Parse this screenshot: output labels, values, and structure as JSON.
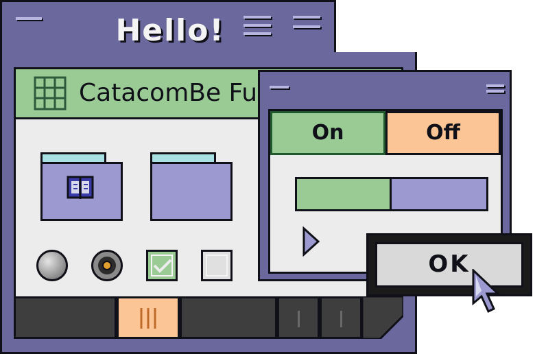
{
  "main_window": {
    "title": "Hello!",
    "path_label": "CatacomBe Fu"
  },
  "dialog": {
    "toggle_on_label": "On",
    "toggle_off_label": "Off",
    "toggle_selected": "On",
    "progress": 0.5
  },
  "ok_button": {
    "label": "OK"
  },
  "colors": {
    "window_frame": "#6a689c",
    "accent_green": "#9bcb95",
    "accent_orange": "#fbc596",
    "folder_purple": "#9b99cf",
    "folder_tab": "#a9e0e2",
    "content_bg": "#ececec"
  },
  "icons": {
    "main_menu": "menu-bar-icon",
    "main_resize": "resize-icon",
    "path": "grid-icon",
    "folder_1_badge": "book-icon",
    "dialog_menu": "menu-bar-icon",
    "dialog_resize": "resize-icon",
    "expand": "triangle-right-icon",
    "status_active": "tally-icon",
    "cursor": "pointer-cursor-icon"
  },
  "checkboxes": [
    {
      "checked": true
    },
    {
      "checked": false
    }
  ],
  "radios": [
    {
      "selected": false
    },
    {
      "selected": true
    }
  ]
}
